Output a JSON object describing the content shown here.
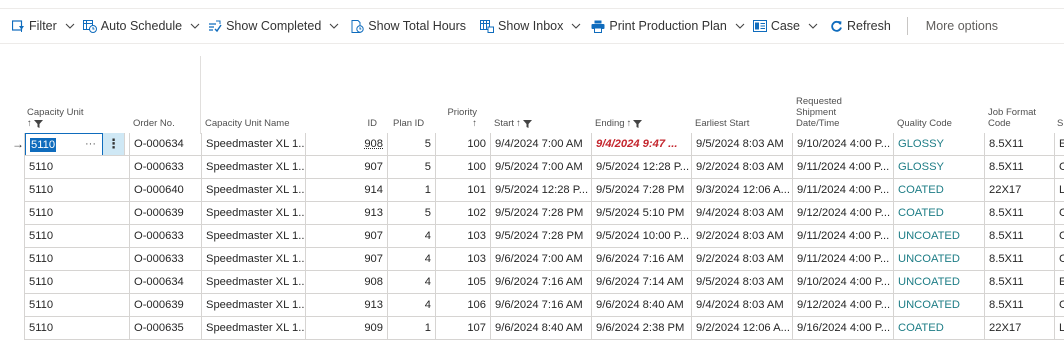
{
  "toolbar": {
    "filter": "Filter",
    "auto_schedule": "Auto Schedule",
    "show_completed": "Show Completed",
    "show_total_hours": "Show Total Hours",
    "show_inbox": "Show Inbox",
    "print_production_plan": "Print Production Plan",
    "case": "Case",
    "refresh": "Refresh",
    "more_options": "More options"
  },
  "columns": {
    "capacity_unit": "Capacity Unit",
    "order_no": "Order No.",
    "capacity_unit_name": "Capacity Unit Name",
    "id": "ID",
    "plan_id": "Plan ID",
    "priority": "Priority",
    "start": "Start",
    "ending": "Ending",
    "earliest_start": "Earliest Start",
    "requested_shipment_1": "Requested",
    "requested_shipment_2": "Shipment",
    "requested_shipment_3": "Date/Time",
    "quality_code": "Quality Code",
    "job_format_1": "Job Format",
    "job_format_2": "Code",
    "sort_up": "↑",
    "next_col": "S"
  },
  "rows": [
    {
      "capacity_unit": "5110",
      "order_no": "O-000634",
      "name": "Speedmaster XL 1...",
      "id": "908",
      "plan_id": "5",
      "priority": "100",
      "start": "9/4/2024 7:00 AM",
      "ending": "9/4/2024 9:47 ...",
      "earliest_start": "9/5/2024 8:03 AM",
      "requested": "9/10/2024 4:00 P...",
      "quality": "GLOSSY",
      "job_format": "8.5X11",
      "next": "E"
    },
    {
      "capacity_unit": "5110",
      "order_no": "O-000633",
      "name": "Speedmaster XL 1...",
      "id": "907",
      "plan_id": "5",
      "priority": "100",
      "start": "9/5/2024 7:00 AM",
      "ending": "9/5/2024 12:28 P...",
      "earliest_start": "9/2/2024 8:03 AM",
      "requested": "9/11/2024 4:00 P...",
      "quality": "GLOSSY",
      "job_format": "8.5X11",
      "next": "C"
    },
    {
      "capacity_unit": "5110",
      "order_no": "O-000640",
      "name": "Speedmaster XL 1...",
      "id": "914",
      "plan_id": "1",
      "priority": "101",
      "start": "9/5/2024 12:28 P...",
      "ending": "9/5/2024 7:28 PM",
      "earliest_start": "9/3/2024 12:06 A...",
      "requested": "9/11/2024 4:00 P...",
      "quality": "COATED",
      "job_format": "22X17",
      "next": "L"
    },
    {
      "capacity_unit": "5110",
      "order_no": "O-000639",
      "name": "Speedmaster XL 1...",
      "id": "913",
      "plan_id": "5",
      "priority": "102",
      "start": "9/5/2024 7:28 PM",
      "ending": "9/5/2024 5:10 PM",
      "earliest_start": "9/4/2024 8:03 AM",
      "requested": "9/12/2024 4:00 P...",
      "quality": "COATED",
      "job_format": "8.5X11",
      "next": "C"
    },
    {
      "capacity_unit": "5110",
      "order_no": "O-000633",
      "name": "Speedmaster XL 1...",
      "id": "907",
      "plan_id": "4",
      "priority": "103",
      "start": "9/5/2024 7:28 PM",
      "ending": "9/5/2024 10:00 P...",
      "earliest_start": "9/2/2024 8:03 AM",
      "requested": "9/11/2024 4:00 P...",
      "quality": "UNCOATED",
      "job_format": "8.5X11",
      "next": "C"
    },
    {
      "capacity_unit": "5110",
      "order_no": "O-000633",
      "name": "Speedmaster XL 1...",
      "id": "907",
      "plan_id": "4",
      "priority": "103",
      "start": "9/6/2024 7:00 AM",
      "ending": "9/6/2024 7:16 AM",
      "earliest_start": "9/2/2024 8:03 AM",
      "requested": "9/11/2024 4:00 P...",
      "quality": "UNCOATED",
      "job_format": "8.5X11",
      "next": "C"
    },
    {
      "capacity_unit": "5110",
      "order_no": "O-000634",
      "name": "Speedmaster XL 1...",
      "id": "908",
      "plan_id": "4",
      "priority": "105",
      "start": "9/6/2024 7:16 AM",
      "ending": "9/6/2024 7:14 AM",
      "earliest_start": "9/5/2024 8:03 AM",
      "requested": "9/10/2024 4:00 P...",
      "quality": "UNCOATED",
      "job_format": "8.5X11",
      "next": "E"
    },
    {
      "capacity_unit": "5110",
      "order_no": "O-000639",
      "name": "Speedmaster XL 1...",
      "id": "913",
      "plan_id": "4",
      "priority": "106",
      "start": "9/6/2024 7:16 AM",
      "ending": "9/6/2024 8:40 AM",
      "earliest_start": "9/4/2024 8:03 AM",
      "requested": "9/12/2024 4:00 P...",
      "quality": "UNCOATED",
      "job_format": "8.5X11",
      "next": "C"
    },
    {
      "capacity_unit": "5110",
      "order_no": "O-000635",
      "name": "Speedmaster XL 1...",
      "id": "909",
      "plan_id": "1",
      "priority": "107",
      "start": "9/6/2024 8:40 AM",
      "ending": "9/6/2024 2:38 PM",
      "earliest_start": "9/2/2024 12:06 A...",
      "requested": "9/16/2024 4:00 P...",
      "quality": "COATED",
      "job_format": "22X17",
      "next": "L"
    }
  ],
  "selection": {
    "row_arrow": "→",
    "more_dots": "···",
    "kebab": "⋮"
  },
  "colors": {
    "accent": "#0f6cbd",
    "quality_code": "#1e7d86",
    "ending_alert": "#c4262e"
  }
}
